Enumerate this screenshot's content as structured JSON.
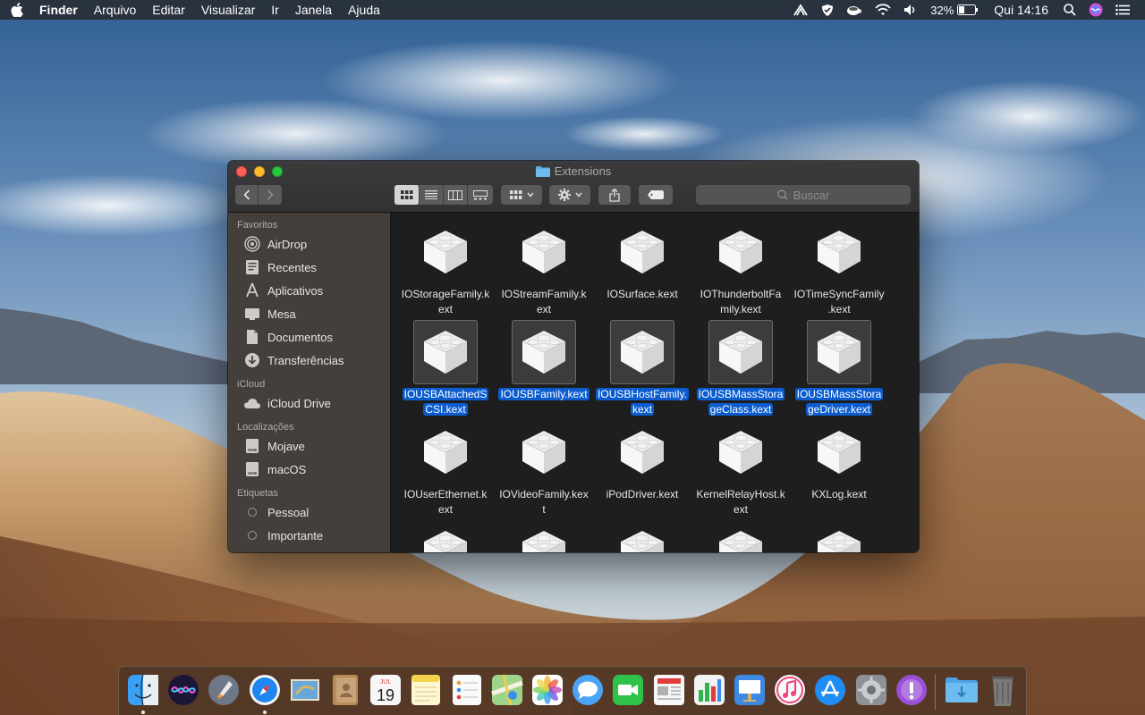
{
  "menubar": {
    "app_name": "Finder",
    "menus": [
      "Arquivo",
      "Editar",
      "Visualizar",
      "Ir",
      "Janela",
      "Ajuda"
    ],
    "battery": "32%",
    "clock": "Qui 14:16",
    "status_icons": [
      "airplay-icon",
      "shield-icon",
      "coffee-icon",
      "wifi-icon",
      "volume-icon",
      "battery-icon",
      "search-icon",
      "siri-icon",
      "notification-center-icon"
    ]
  },
  "window": {
    "title": "Extensions",
    "search_placeholder": "Buscar",
    "view_modes": [
      "icon-view",
      "list-view",
      "column-view",
      "gallery-view"
    ],
    "active_view": "icon-view"
  },
  "sidebar": {
    "sections": [
      {
        "title": "Favoritos",
        "items": [
          {
            "label": "AirDrop",
            "icon": "airdrop-icon"
          },
          {
            "label": "Recentes",
            "icon": "recents-icon"
          },
          {
            "label": "Aplicativos",
            "icon": "applications-icon"
          },
          {
            "label": "Mesa",
            "icon": "desktop-icon"
          },
          {
            "label": "Documentos",
            "icon": "documents-icon"
          },
          {
            "label": "Transferências",
            "icon": "downloads-icon"
          }
        ]
      },
      {
        "title": "iCloud",
        "items": [
          {
            "label": "iCloud Drive",
            "icon": "cloud-icon"
          }
        ]
      },
      {
        "title": "Localizações",
        "items": [
          {
            "label": "Mojave",
            "icon": "disk-icon"
          },
          {
            "label": "macOS",
            "icon": "disk-icon"
          }
        ]
      },
      {
        "title": "Etiquetas",
        "items": [
          {
            "label": "Pessoal",
            "icon": "tag-icon"
          },
          {
            "label": "Importante",
            "icon": "tag-icon"
          }
        ]
      }
    ]
  },
  "files": [
    {
      "name": "IOStorageFamily.kext",
      "lines": [
        "IOStorageFamily.k",
        "ext"
      ],
      "selected": false
    },
    {
      "name": "IOStreamFamily.kext",
      "lines": [
        "IOStreamFamily.k",
        "ext"
      ],
      "selected": false
    },
    {
      "name": "IOSurface.kext",
      "lines": [
        "IOSurface.kext"
      ],
      "selected": false
    },
    {
      "name": "IOThunderboltFamily.kext",
      "lines": [
        "IOThunderboltFa",
        "mily.kext"
      ],
      "selected": false
    },
    {
      "name": "IOTimeSyncFamily.kext",
      "lines": [
        "IOTimeSyncFamily",
        ".kext"
      ],
      "selected": false
    },
    {
      "name": "IOUSBAttachedSCSI.kext",
      "lines": [
        "IOUSBAttachedS",
        "CSI.kext"
      ],
      "selected": true
    },
    {
      "name": "IOUSBFamily.kext",
      "lines": [
        "IOUSBFamily.kext"
      ],
      "selected": true
    },
    {
      "name": "IOUSBHostFamily.kext",
      "lines": [
        "IOUSBHostFamily.",
        "kext"
      ],
      "selected": true
    },
    {
      "name": "IOUSBMassStorageClass.kext",
      "lines": [
        "IOUSBMassStora",
        "geClass.kext"
      ],
      "selected": true
    },
    {
      "name": "IOUSBMassStorageDriver.kext",
      "lines": [
        "IOUSBMassStora",
        "geDriver.kext"
      ],
      "selected": true
    },
    {
      "name": "IOUserEthernet.kext",
      "lines": [
        "IOUserEthernet.k",
        "ext"
      ],
      "selected": false
    },
    {
      "name": "IOVideoFamily.kext",
      "lines": [
        "IOVideoFamily.kex",
        "t"
      ],
      "selected": false
    },
    {
      "name": "iPodDriver.kext",
      "lines": [
        "iPodDriver.kext"
      ],
      "selected": false
    },
    {
      "name": "KernelRelayHost.kext",
      "lines": [
        "KernelRelayHost.k",
        "ext"
      ],
      "selected": false
    },
    {
      "name": "KXLog.kext",
      "lines": [
        "KXLog.kext"
      ],
      "selected": false
    },
    {
      "name": "",
      "lines": [],
      "selected": false
    },
    {
      "name": "",
      "lines": [],
      "selected": false
    },
    {
      "name": "",
      "lines": [],
      "selected": false
    },
    {
      "name": "",
      "lines": [],
      "selected": false
    },
    {
      "name": "",
      "lines": [],
      "selected": false
    }
  ],
  "dock": {
    "apps": [
      {
        "name": "finder",
        "color": "#2a8ef0",
        "running": true
      },
      {
        "name": "siri",
        "color": "#2a1f5a",
        "running": false
      },
      {
        "name": "launchpad",
        "color": "#7d8896",
        "running": false
      },
      {
        "name": "safari",
        "color": "#1e86f2",
        "running": true
      },
      {
        "name": "mail",
        "color": "#6aa7d9",
        "running": false
      },
      {
        "name": "contacts",
        "color": "#b68b55",
        "running": false
      },
      {
        "name": "calendar",
        "color": "#f4f4f4",
        "running": false,
        "text": "19",
        "subtext": "JUL"
      },
      {
        "name": "notes",
        "color": "#f8e27a",
        "running": false
      },
      {
        "name": "reminders",
        "color": "#f2f2f2",
        "running": false
      },
      {
        "name": "maps",
        "color": "#8ec97a",
        "running": false
      },
      {
        "name": "photos",
        "color": "#f6f6f6",
        "running": false
      },
      {
        "name": "messages",
        "color": "#4aa3f5",
        "running": false
      },
      {
        "name": "facetime",
        "color": "#2fc24a",
        "running": false
      },
      {
        "name": "news",
        "color": "#f3f3f3",
        "running": false
      },
      {
        "name": "numbers",
        "color": "#f0f0f0",
        "running": false
      },
      {
        "name": "keynote",
        "color": "#3d88e0",
        "running": false
      },
      {
        "name": "itunes",
        "color": "#fafafa",
        "running": false
      },
      {
        "name": "app-store",
        "color": "#1f8df5",
        "running": false
      },
      {
        "name": "system-preferences",
        "color": "#8d9096",
        "running": false
      },
      {
        "name": "feedback-assistant",
        "color": "#9b4fd6",
        "running": false
      }
    ],
    "trailing": [
      {
        "name": "downloads-stack",
        "color": "#4ea3e8"
      },
      {
        "name": "trash",
        "color": "#6c6c6c"
      }
    ]
  }
}
